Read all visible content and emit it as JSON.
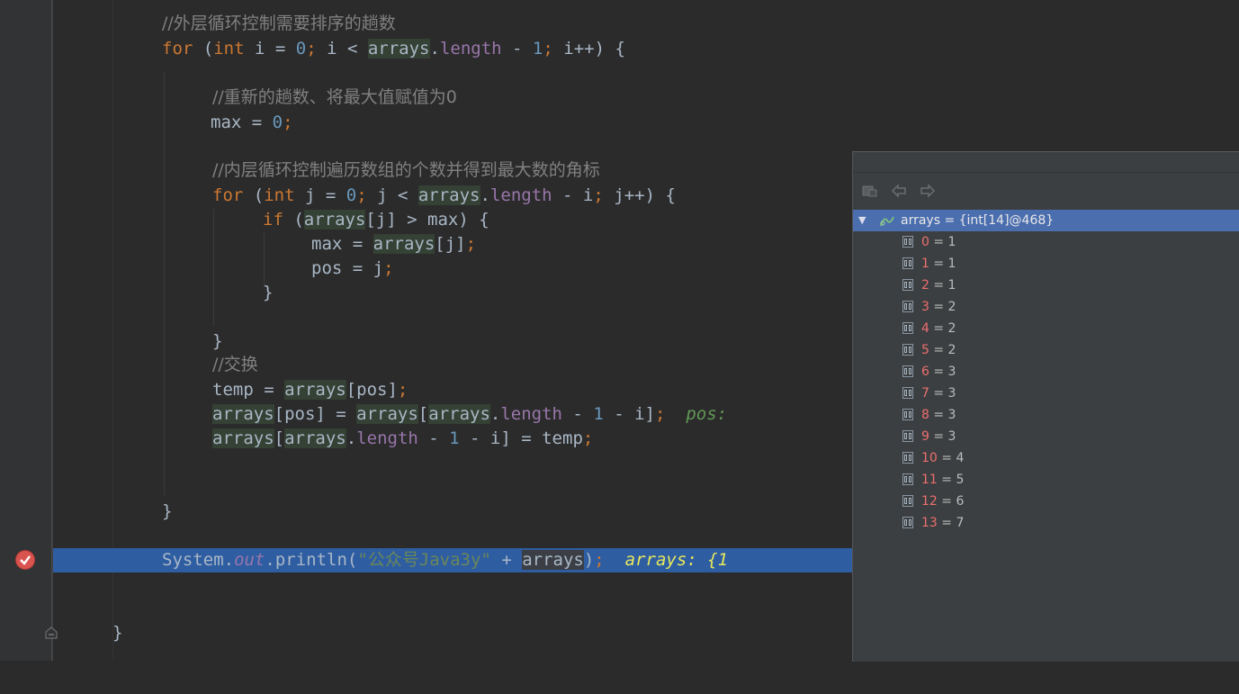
{
  "editor": {
    "lines": {
      "c1": "//外层循环控制需要排序的趟数",
      "for1_kw": "for",
      "for1_open": " (",
      "for1_int": "int",
      "for1_a": " i = ",
      "for1_zero": "0",
      "for1_semi1": ";",
      "for1_b": " i < ",
      "for1_arrays": "arrays",
      "for1_dot": ".",
      "for1_length": "length",
      "for1_minus": " - ",
      "for1_one": "1",
      "for1_semi2": ";",
      "for1_c": " i++) {",
      "c2": "//重新的趟数、将最大值赋值为0",
      "max_a": "max = ",
      "max_zero": "0",
      "max_semi": ";",
      "c3": "//内层循环控制遍历数组的个数并得到最大数的角标",
      "for2_kw": "for",
      "for2_open": " (",
      "for2_int": "int",
      "for2_a": " j = ",
      "for2_zero": "0",
      "for2_semi1": ";",
      "for2_b": " j < ",
      "for2_arrays": "arrays",
      "for2_dot": ".",
      "for2_length": "length",
      "for2_c": " - i",
      "for2_semi2": ";",
      "for2_d": " j++) {",
      "if_kw": "if",
      "if_a": " (",
      "if_arrays": "arrays",
      "if_b": "[j] > max) {",
      "maxa_a": "max = ",
      "maxa_arrays": "arrays",
      "maxa_b": "[j]",
      "maxa_semi": ";",
      "pos_a": "pos = j",
      "pos_semi": ";",
      "close_if": "}",
      "close_for2": "}",
      "c4": "//交换",
      "temp_a": "temp = ",
      "temp_arrays": "arrays",
      "temp_b": "[pos]",
      "temp_semi": ";",
      "sw1_arrays1": "arrays",
      "sw1_a": "[pos] = ",
      "sw1_arrays2": "arrays",
      "sw1_b": "[",
      "sw1_arrays3": "arrays",
      "sw1_dot": ".",
      "sw1_length": "length",
      "sw1_c": " - ",
      "sw1_one": "1",
      "sw1_d": " - i]",
      "sw1_semi": ";",
      "sw1_hint": "pos:",
      "sw2_arrays1": "arrays",
      "sw2_b": "[",
      "sw2_arrays2": "arrays",
      "sw2_dot": ".",
      "sw2_length": "length",
      "sw2_c": " - ",
      "sw2_one": "1",
      "sw2_d": " - i] = temp",
      "sw2_semi": ";",
      "close_for1": "}",
      "pr_a": "System.",
      "pr_out": "out",
      "pr_b": ".println(",
      "pr_str": "\"公众号Java3y\"",
      "pr_c": " + ",
      "pr_arrays": "arrays",
      "pr_d": ")",
      "pr_semi": ";",
      "pr_hint": "arrays: {1",
      "close_method": "}"
    }
  },
  "debug_popup": {
    "root_label": "arrays = {int[14]@468}",
    "items": [
      {
        "index": "0",
        "value": " = 1"
      },
      {
        "index": "1",
        "value": " = 1"
      },
      {
        "index": "2",
        "value": " = 1"
      },
      {
        "index": "3",
        "value": " = 2"
      },
      {
        "index": "4",
        "value": " = 2"
      },
      {
        "index": "5",
        "value": " = 2"
      },
      {
        "index": "6",
        "value": " = 3"
      },
      {
        "index": "7",
        "value": " = 3"
      },
      {
        "index": "8",
        "value": " = 3"
      },
      {
        "index": "9",
        "value": " = 3"
      },
      {
        "index": "10",
        "value": " = 4"
      },
      {
        "index": "11",
        "value": " = 5"
      },
      {
        "index": "12",
        "value": " = 6"
      },
      {
        "index": "13",
        "value": " = 7"
      }
    ]
  },
  "icons": {
    "breakpoint": "breakpoint-check-icon",
    "fold": "fold-marker-icon",
    "nav_back": "back-arrow-icon",
    "nav_forward": "forward-arrow-icon",
    "watch": "watch-icon"
  },
  "colors": {
    "editor_bg": "#2b2b2b",
    "keyword": "#cc7832",
    "number": "#6897bb",
    "comment": "#808080",
    "field": "#9876aa",
    "string": "#6a8759",
    "current_line": "#2e5da2",
    "popup_selection": "#4b6eaf",
    "array_index": "#ec6e6e"
  }
}
